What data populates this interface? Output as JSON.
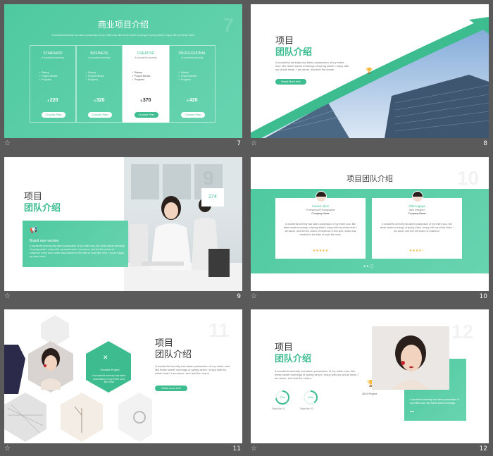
{
  "colors": {
    "accent": "#3dbd8f",
    "accent_light": "#68d4b0",
    "frame_bg": "#5a5a5a"
  },
  "slides": [
    {
      "number": "7",
      "bg_number": "7",
      "title": "商业项目介绍",
      "subtitle": "A wonderful serenity has taken possession of my entire soul, like these sweet mornings of spring which I enjoy with my whole heart.",
      "plans": [
        {
          "name": "STANDARD",
          "sub": "A wonderful serenity",
          "features": [
            "Startup",
            "Project Mentor",
            "Progress"
          ],
          "price": "220",
          "button": "Choose Plan"
        },
        {
          "name": "BUSINESS",
          "sub": "A wonderful serenity",
          "features": [
            "Startup",
            "Project Mentor",
            "Progress"
          ],
          "price": "320",
          "button": "Choose Plan"
        },
        {
          "name": "CREATIVE",
          "sub": "A wonderful serenity",
          "features": [
            "Startup",
            "Project Mentor",
            "Progress"
          ],
          "price": "370",
          "button": "Choose Plan"
        },
        {
          "name": "PROFESSIONAL",
          "sub": "A wonderful serenity",
          "features": [
            "Startup",
            "Project Mentor",
            "Progress"
          ],
          "price": "420",
          "button": "Choose Plan"
        }
      ]
    },
    {
      "number": "8",
      "title1": "项目",
      "title2": "团队介绍",
      "body": "A wonderful serenity has taken possession of my entire soul, like these sweet mornings of spring which I enjoy with my whole heart. I am alone, and feel the charm.",
      "button": "Read More text"
    },
    {
      "number": "9",
      "bg_number": "9",
      "title1": "项目",
      "title2": "团队介绍",
      "box_title": "Brand new version",
      "box_body": "A wonderful serenity has taken possession of my entire soul, like these sweet mornings of spring which I enjoy with my whole heart. I am alone, and feel the charm of existence in this spot, which was created for the bliss of souls like mine. I am so happy, my dear friend.",
      "stat": "274"
    },
    {
      "number": "10",
      "bg_number": "10",
      "title": "项目团队介绍",
      "members": [
        {
          "name": "Louise Alice",
          "role": "Professional Photographer",
          "company": "Company Name",
          "quote": "A wonderful serenity has taken possession of my entire soul, like these sweet mornings of spring which I enjoy with my whole heart. I am alone, and feel the charm of existence in this spot, which was created for the bliss of souls like mine.",
          "stars": "★★★★★"
        },
        {
          "name": "Odel Agaya",
          "role": "Web Designer",
          "company": "Company Name",
          "quote": "A wonderful serenity has taken possession of my entire soul, like these sweet mornings of spring which I enjoy with my whole heart. I am alone, and feel the charm of existence.",
          "stars": "★★★★☆"
        }
      ]
    },
    {
      "number": "11",
      "bg_number": "11",
      "title1": "项目",
      "title2": "团队介绍",
      "body": "A wonderful serenity has taken possession of my entire soul, like these sweet mornings of spring which I enjoy with my whole heart. I am alone, and feel the charm.",
      "hex_title": "Creative Project",
      "hex_body": "A wonderful serenity has taken possession of my entire soul, like these",
      "button": "Read more text"
    },
    {
      "number": "12",
      "bg_number": "12",
      "title1": "项目",
      "title2": "团队介绍",
      "body": "A wonderful serenity has taken possession of my entire soul, like these sweet mornings of spring which I enjoy with my whole heart. I am alone, and feel the charm.",
      "stats": [
        {
          "value": "73%",
          "label": "Data title 01",
          "progress": 0.73
        },
        {
          "value": "40%",
          "label": "Data title 02",
          "progress": 0.4
        }
      ],
      "year_label": "2019 Project",
      "box_body": "A wonderful serenity has taken possession of my entire soul, like these sweet mornings."
    }
  ]
}
